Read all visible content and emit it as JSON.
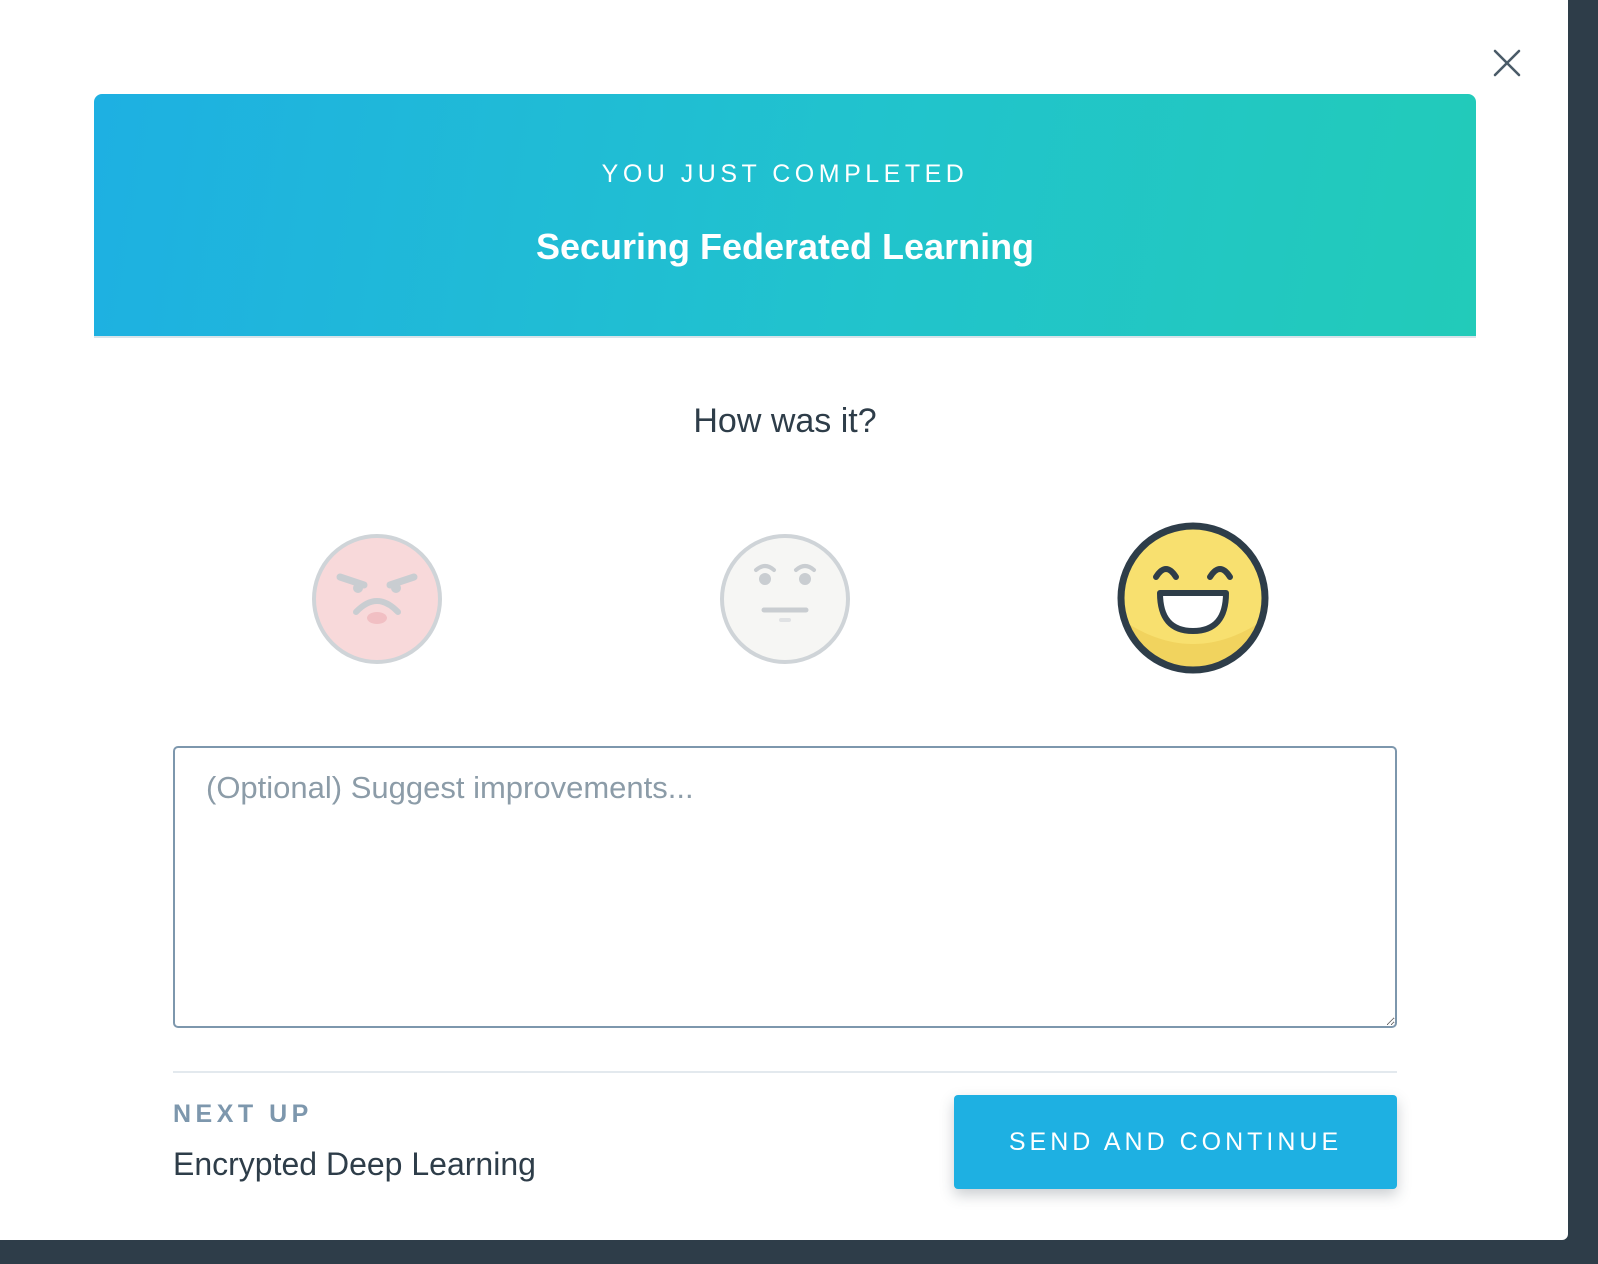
{
  "banner": {
    "eyebrow": "YOU JUST COMPLETED",
    "title": "Securing Federated Learning"
  },
  "rating": {
    "question": "How was it?",
    "options": [
      {
        "icon": "angry-face-icon",
        "selected": false
      },
      {
        "icon": "neutral-face-icon",
        "selected": false
      },
      {
        "icon": "happy-face-icon",
        "selected": true
      }
    ]
  },
  "feedback": {
    "placeholder": "(Optional) Suggest improvements...",
    "value": ""
  },
  "next_up": {
    "label": "NEXT UP",
    "title": "Encrypted Deep Learning"
  },
  "actions": {
    "send_label": "SEND AND CONTINUE"
  },
  "colors": {
    "accent": "#1eb0e2",
    "gradient_end": "#22cbb9",
    "text_dark": "#2e3d49",
    "text_muted": "#7d97ad"
  }
}
